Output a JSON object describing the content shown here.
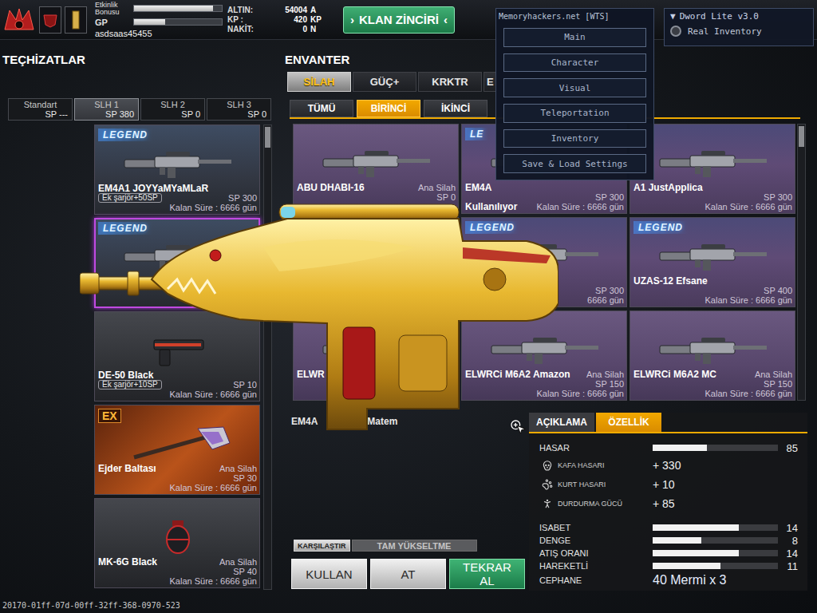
{
  "top_bar": {
    "bonus_label": "Etkinlik Bonusu",
    "bonus_level": 0.9,
    "gp_label": "GP",
    "gp_level": 0.35,
    "username": "asdsaas45455",
    "currencies": [
      {
        "label": "ALTIN:",
        "value": "54004",
        "unit": "A"
      },
      {
        "label": "KP :",
        "value": "420",
        "unit": "KP"
      },
      {
        "label": "NAKİT:",
        "value": "0",
        "unit": "N"
      }
    ],
    "clan_button": {
      "left_mark": "›",
      "label": "KLAN ZİNCİRİ",
      "right_mark": "‹"
    }
  },
  "equipment": {
    "title": "TEÇHİZATLAR",
    "tabs": [
      {
        "label": "Standart",
        "sp": "SP ---",
        "selected": false
      },
      {
        "label": "SLH 1",
        "sp": "SP 380",
        "selected": true
      },
      {
        "label": "SLH 2",
        "sp": "SP 0",
        "selected": false
      },
      {
        "label": "SLH 3",
        "sp": "SP 0",
        "selected": false
      }
    ],
    "cards": [
      {
        "kind": "rifle",
        "rarity": "legend",
        "badge": "LEGEND",
        "name": "EM4A1 JOYYaMYaMLaR",
        "tag": "Ek şarjör+50SP",
        "sp": "SP 300",
        "time": "Kalan Süre : 6666 gün",
        "selected": false
      },
      {
        "kind": "rifle",
        "rarity": "legend",
        "badge": "LEGEND",
        "selected": true
      },
      {
        "kind": "pistol",
        "rarity": "normal",
        "name": "DE-50 Black",
        "tag": "Ek şarjör+10SP",
        "sp": "SP 10",
        "time": "Kalan Süre : 6666 gün",
        "selected": false
      },
      {
        "kind": "axe",
        "rarity": "ex",
        "badge": "EX",
        "name": "Ejder Baltası",
        "type": "Ana Silah",
        "sp": "SP 30",
        "time": "Kalan Süre : 6666 gün",
        "selected": false
      },
      {
        "kind": "grenade",
        "rarity": "normal",
        "name": "MK-6G Black",
        "type": "Ana Silah",
        "sp": "SP 40",
        "time": "Kalan Süre : 6666 gün",
        "selected": false
      }
    ]
  },
  "inventory": {
    "title": "ENVANTER",
    "tabs": [
      {
        "label": "SİLAH",
        "selected": true
      },
      {
        "label": "GÜÇ+",
        "selected": false
      },
      {
        "label": "KRKTR",
        "selected": false
      },
      {
        "label": "E",
        "selected": false
      }
    ],
    "sub_tabs": [
      {
        "label": "TÜMÜ",
        "selected": false
      },
      {
        "label": "BİRİNCİ",
        "selected": true
      },
      {
        "label": "İKİNCİ",
        "selected": false
      }
    ],
    "items": [
      {
        "kind": "rifle",
        "rarity": "normal",
        "name": "ABU DHABI-16",
        "type": "Ana Silah",
        "sp": "SP 0",
        "selected": false
      },
      {
        "kind": "rifle",
        "rarity": "legend",
        "badge": "LE",
        "name": "EM4A",
        "sp": "SP 300",
        "status": "Kullanılıyor",
        "time": "Kalan Süre : 6666 gün",
        "selected": false
      },
      {
        "kind": "rifle",
        "rarity": "legend",
        "name": "A1 JustApplica",
        "sp": "SP 300",
        "time": "Kalan Süre : 6666 gün",
        "selected": false
      },
      {
        "kind": "rifle",
        "rarity": "normal",
        "selected": false
      },
      {
        "kind": "rifle",
        "rarity": "legend",
        "badge": "LEGEND",
        "sp": "SP 300",
        "time": "6666 gün",
        "selected": false
      },
      {
        "kind": "rifle",
        "rarity": "legend",
        "badge": "LEGEND",
        "name": "UZAS-12 Efsane",
        "sp": "SP 400",
        "time": "Kalan Süre : 6666 gün",
        "selected": false
      },
      {
        "kind": "rifle",
        "rarity": "normal",
        "name": "ELWR",
        "selected": false
      },
      {
        "kind": "rifle",
        "rarity": "normal",
        "name": "ELWRCi M6A2 Amazon",
        "type": "Ana Silah",
        "sp": "SP 150",
        "time": "Kalan Süre : 6666 gün",
        "selected": false
      },
      {
        "kind": "rifle",
        "rarity": "normal",
        "name": "ELWRCi M6A2 MC",
        "type": "Ana Silah",
        "sp": "SP 150",
        "time": "Kalan Süre : 6666 gün",
        "selected": false
      }
    ]
  },
  "details": {
    "name_parts": [
      "EM4A",
      "Matem"
    ],
    "small_buttons": [
      {
        "label": "KARŞILAŞTIR",
        "disabled": false
      },
      {
        "label": "TAM YÜKSELTME",
        "disabled": true
      }
    ],
    "action_buttons": [
      {
        "label": "KULLAN",
        "kind": "plain"
      },
      {
        "label": "AT",
        "kind": "plain"
      },
      {
        "label": "TEKRAR AL",
        "kind": "primary"
      }
    ],
    "stat_tabs": [
      {
        "label": "AÇIKLAMA",
        "selected": false
      },
      {
        "label": "ÖZELLİK",
        "selected": true
      }
    ],
    "stats": [
      {
        "kind": "bar",
        "label": "HASAR",
        "level": 0.43,
        "value": "85"
      },
      {
        "kind": "bonus",
        "label": "KAFA HASARI",
        "value": "+ 330"
      },
      {
        "kind": "bonus",
        "label": "KURT HASARI",
        "value": "+ 10"
      },
      {
        "kind": "bonus",
        "label": "DURDURMA GÜCÜ",
        "value": "+ 85"
      },
      {
        "kind": "bar",
        "label": "ISABET",
        "level": 0.69,
        "value": "14"
      },
      {
        "kind": "bar",
        "label": "DENGE",
        "level": 0.39,
        "value": "8"
      },
      {
        "kind": "bar",
        "label": "ATIŞ ORANI",
        "level": 0.69,
        "value": "14"
      },
      {
        "kind": "bar",
        "label": "HAREKETLİ",
        "level": 0.54,
        "value": "11"
      },
      {
        "kind": "text",
        "label": "CEPHANE",
        "value": "40 Mermi x 3"
      }
    ]
  },
  "footer": "20170-01ff-07d-00ff-32ff-368-0970-523",
  "cheat_menu": {
    "title": "Memoryhackers.net [WTS]",
    "items": [
      "Main",
      "Character",
      "Visual",
      "Teleportation",
      "Inventory",
      "Save & Load Settings"
    ]
  },
  "dword_panel": {
    "arrow": "▼",
    "title": "Dword Lite v3.0",
    "options": [
      {
        "label": "Real Inventory",
        "on": false
      }
    ]
  }
}
